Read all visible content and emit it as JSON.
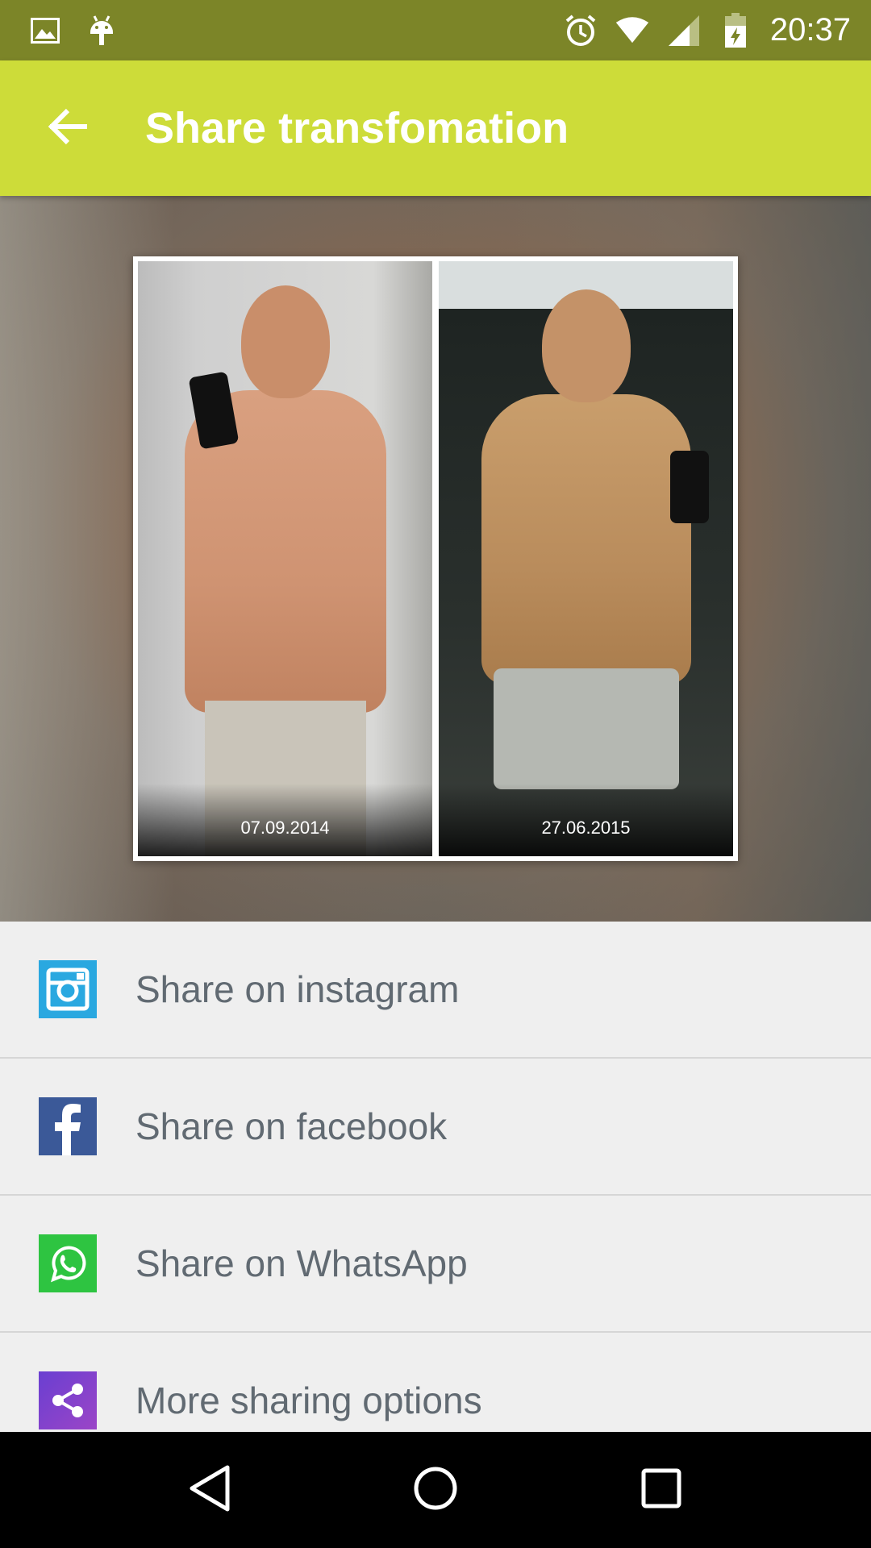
{
  "status_bar": {
    "time": "20:37",
    "left_icons": [
      "image-icon",
      "android-icon"
    ],
    "right_icons": [
      "alarm-icon",
      "wifi-icon",
      "signal-icon",
      "battery-icon"
    ],
    "background": "#7c8528"
  },
  "app_bar": {
    "title": "Share transfomation",
    "back_icon": "arrow-back-icon",
    "background": "#cddc39"
  },
  "preview": {
    "photos": [
      {
        "date": "07.09.2014"
      },
      {
        "date": "27.06.2015"
      }
    ]
  },
  "share_options": [
    {
      "label": "Share on instagram",
      "icon": "instagram-icon",
      "color": "#2aa8e0"
    },
    {
      "label": "Share on facebook",
      "icon": "facebook-icon",
      "color": "#3b5998"
    },
    {
      "label": "Share on WhatsApp",
      "icon": "whatsapp-icon",
      "color": "#2ec441"
    },
    {
      "label": "More sharing options",
      "icon": "share-icon",
      "color": "#7b3fcf"
    }
  ],
  "nav_bar": {
    "buttons": [
      "back-nav-icon",
      "home-nav-icon",
      "recents-nav-icon"
    ]
  }
}
